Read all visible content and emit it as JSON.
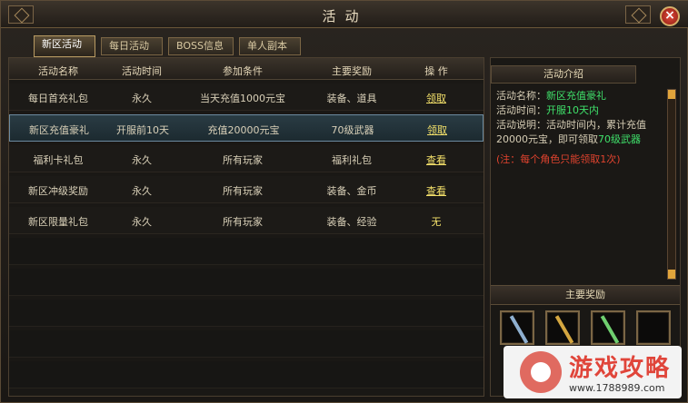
{
  "window": {
    "title": "活动"
  },
  "tabs": [
    {
      "label": "新区活动",
      "active": true
    },
    {
      "label": "每日活动",
      "active": false
    },
    {
      "label": "BOSS信息",
      "active": false
    },
    {
      "label": "单人副本",
      "active": false
    }
  ],
  "table": {
    "headers": [
      "活动名称",
      "活动时间",
      "参加条件",
      "主要奖励",
      "操 作"
    ],
    "rows": [
      {
        "name": "每日首充礼包",
        "time": "永久",
        "cond": "当天充值1000元宝",
        "reward": "装备、道具",
        "op": "领取",
        "op_link": true
      },
      {
        "name": "新区充值豪礼",
        "time": "开服前10天",
        "cond": "充值20000元宝",
        "reward": "70级武器",
        "op": "领取",
        "op_link": true
      },
      {
        "name": "福利卡礼包",
        "time": "永久",
        "cond": "所有玩家",
        "reward": "福利礼包",
        "op": "查看",
        "op_link": true
      },
      {
        "name": "新区冲级奖励",
        "time": "永久",
        "cond": "所有玩家",
        "reward": "装备、金币",
        "op": "查看",
        "op_link": true
      },
      {
        "name": "新区限量礼包",
        "time": "永久",
        "cond": "所有玩家",
        "reward": "装备、经验",
        "op": "无",
        "op_link": false
      }
    ],
    "selected_row": 1
  },
  "side": {
    "intro_title": "活动介绍",
    "name_label": "活动名称：",
    "name_value": "新区充值豪礼",
    "time_label": "活动时间：",
    "time_value": "开服10天内",
    "desc_label": "活动说明：活动时间内，累计充值20000元宝，即可领取",
    "desc_value": "70级武器",
    "note": "(注：每个角色只能领取1次)",
    "reward_title": "主要奖励",
    "reward_slots": [
      {
        "icon": "staff-icon",
        "color": "#8fb0d0"
      },
      {
        "icon": "scepter-icon",
        "color": "#d4a640"
      },
      {
        "icon": "spear-icon",
        "color": "#6fcf6f"
      },
      {
        "icon": "empty-slot-icon",
        "color": "#2a2a2a"
      }
    ]
  },
  "watermark": {
    "title": "游戏攻略",
    "url": "www.1788989.com"
  },
  "colors": {
    "accent_gold": "#f3e06a",
    "value_green": "#3fe06a",
    "note_red": "#e0432e",
    "close_red": "#e04b3b"
  }
}
